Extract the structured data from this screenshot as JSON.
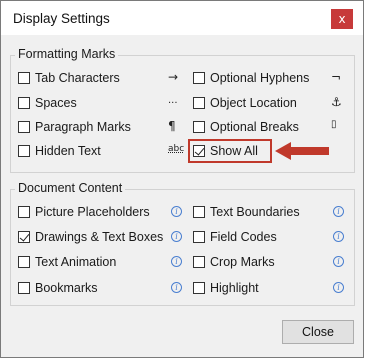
{
  "window": {
    "title": "Display Settings",
    "close_glyph": "x"
  },
  "formatting_marks": {
    "title": "Formatting Marks",
    "left": [
      {
        "label": "Tab Characters",
        "symbol": "→",
        "checked": false
      },
      {
        "label": "Spaces",
        "symbol": "...",
        "checked": false
      },
      {
        "label": "Paragraph Marks",
        "symbol": "¶",
        "checked": false
      },
      {
        "label": "Hidden Text",
        "symbol": "abc",
        "checked": false
      }
    ],
    "right": [
      {
        "label": "Optional Hyphens",
        "symbol": "¬",
        "checked": false
      },
      {
        "label": "Object Location",
        "symbol": "⚓",
        "checked": false
      },
      {
        "label": "Optional Breaks",
        "symbol": "▯",
        "checked": false
      },
      {
        "label": "Show All",
        "checked": true
      }
    ]
  },
  "document_content": {
    "title": "Document Content",
    "left": [
      {
        "label": "Picture Placeholders",
        "checked": false
      },
      {
        "label": "Drawings & Text Boxes",
        "checked": true
      },
      {
        "label": "Text Animation",
        "checked": false
      },
      {
        "label": "Bookmarks",
        "checked": false
      }
    ],
    "right": [
      {
        "label": "Text Boundaries",
        "checked": false
      },
      {
        "label": "Field Codes",
        "checked": false
      },
      {
        "label": "Crop Marks",
        "checked": false
      },
      {
        "label": "Highlight",
        "checked": false
      }
    ],
    "info_glyph": "i"
  },
  "buttons": {
    "close_label": "Close"
  },
  "colors": {
    "close_x_bg": "#c73a3a",
    "annotation": "#c0392b",
    "info": "#4a7fd0"
  }
}
